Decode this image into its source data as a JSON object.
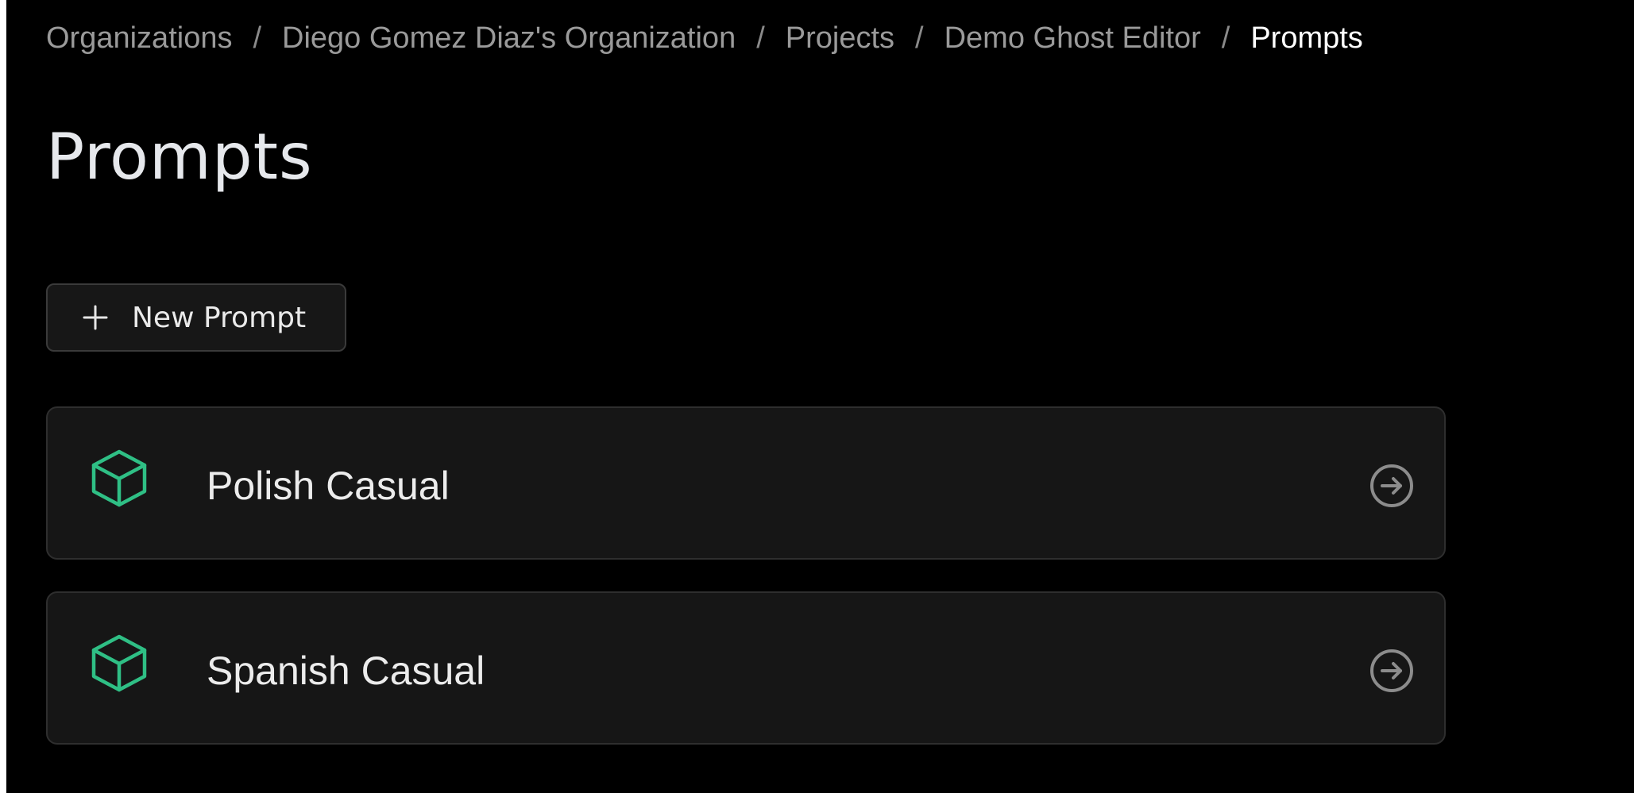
{
  "breadcrumb": {
    "items": [
      {
        "label": "Organizations"
      },
      {
        "label": "Diego Gomez Diaz's Organization"
      },
      {
        "label": "Projects"
      },
      {
        "label": "Demo Ghost Editor"
      }
    ],
    "separator": "/",
    "current": "Prompts"
  },
  "page": {
    "title": "Prompts"
  },
  "toolbar": {
    "new_prompt_label": "New Prompt",
    "new_prompt_icon": "plus-icon"
  },
  "prompts": [
    {
      "name": "Polish Casual",
      "icon": "cube-icon",
      "action_icon": "arrow-right-circle-icon"
    },
    {
      "name": "Spanish Casual",
      "icon": "cube-icon",
      "action_icon": "arrow-right-circle-icon"
    }
  ],
  "colors": {
    "background": "#000000",
    "card_background": "#161616",
    "card_border": "#2e2e2e",
    "accent": "#2fbf85",
    "breadcrumb_muted": "#9a9a9a",
    "text_primary": "#ececec"
  }
}
